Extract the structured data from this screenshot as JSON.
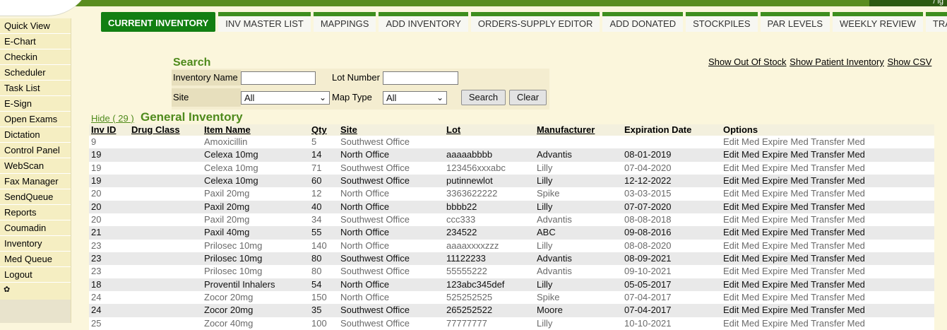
{
  "tabs": [
    "CURRENT INVENTORY",
    "INV MASTER LIST",
    "MAPPINGS",
    "ADD INVENTORY",
    "ORDERS-SUPPLY EDITOR",
    "ADD DONATED",
    "STOCKPILES",
    "PAR LEVELS",
    "WEEKLY REVIEW",
    "TRANSACTIO"
  ],
  "sidebar": [
    "Quick View",
    "E-Chart",
    "Checkin",
    "Scheduler",
    "Task List",
    "E-Sign",
    "Open Exams",
    "Dictation",
    "Control Panel",
    "WebScan",
    "Fax Manager",
    "SendQueue",
    "Reports",
    "Coumadin",
    "Inventory",
    "Med Queue",
    "Logout"
  ],
  "topbar_text": "/ ig",
  "search": {
    "title": "Search",
    "inventory_name_label": "Inventory Name",
    "lot_number_label": "Lot Number",
    "site_label": "Site",
    "site_value": "All",
    "map_type_label": "Map Type",
    "map_type_value": "All",
    "search_button": "Search",
    "clear_button": "Clear"
  },
  "links": {
    "out_of_stock": "Show Out Of Stock",
    "patient_inventory": "Show Patient Inventory",
    "csv": "Show CSV"
  },
  "section": {
    "hide": "Hide ( 29 )",
    "title": "General Inventory"
  },
  "table": {
    "headers": [
      "Inv ID",
      "Drug Class",
      "Item Name",
      "Qty",
      "Site",
      "Lot",
      "Manufacturer",
      "Expiration Date",
      "Options"
    ],
    "options": [
      "Edit Med",
      "Expire Med",
      "Transfer Med"
    ],
    "rows": [
      {
        "inv_id": "9",
        "drug_class": "",
        "item": "Amoxicillin",
        "qty": "5",
        "site": "Southwest Office",
        "lot": "",
        "mfr": "",
        "exp": ""
      },
      {
        "inv_id": "19",
        "drug_class": "",
        "item": "Celexa 10mg",
        "qty": "14",
        "site": "North Office",
        "lot": "aaaaabbbb",
        "mfr": "Advantis",
        "exp": "08-01-2019"
      },
      {
        "inv_id": "19",
        "drug_class": "",
        "item": "Celexa 10mg",
        "qty": "71",
        "site": "Southwest Office",
        "lot": "123456xxxabc",
        "mfr": "Lilly",
        "exp": "07-04-2020"
      },
      {
        "inv_id": "19",
        "drug_class": "",
        "item": "Celexa 10mg",
        "qty": "60",
        "site": "Southwest Office",
        "lot": "putinnewlot",
        "mfr": "Lilly",
        "exp": "12-12-2022"
      },
      {
        "inv_id": "20",
        "drug_class": "",
        "item": "Paxil 20mg",
        "qty": "12",
        "site": "North Office",
        "lot": "3363622222",
        "mfr": "Spike",
        "exp": "03-03-2015"
      },
      {
        "inv_id": "20",
        "drug_class": "",
        "item": "Paxil 20mg",
        "qty": "40",
        "site": "North Office",
        "lot": "bbbb22",
        "mfr": "Lilly",
        "exp": "07-07-2020"
      },
      {
        "inv_id": "20",
        "drug_class": "",
        "item": "Paxil 20mg",
        "qty": "34",
        "site": "Southwest Office",
        "lot": "ccc333",
        "mfr": "Advantis",
        "exp": "08-08-2018"
      },
      {
        "inv_id": "21",
        "drug_class": "",
        "item": "Paxil 40mg",
        "qty": "55",
        "site": "North Office",
        "lot": "234522",
        "mfr": "ABC",
        "exp": "09-08-2016"
      },
      {
        "inv_id": "23",
        "drug_class": "",
        "item": "Prilosec 10mg",
        "qty": "140",
        "site": "North Office",
        "lot": "aaaaxxxxzzz",
        "mfr": "Lilly",
        "exp": "08-08-2020"
      },
      {
        "inv_id": "23",
        "drug_class": "",
        "item": "Prilosec 10mg",
        "qty": "80",
        "site": "Southwest Office",
        "lot": "11122233",
        "mfr": "Advantis",
        "exp": "08-09-2021"
      },
      {
        "inv_id": "23",
        "drug_class": "",
        "item": "Prilosec 10mg",
        "qty": "80",
        "site": "Southwest Office",
        "lot": "55555222",
        "mfr": "Advantis",
        "exp": "09-10-2021"
      },
      {
        "inv_id": "18",
        "drug_class": "",
        "item": "Proventil Inhalers",
        "qty": "54",
        "site": "North Office",
        "lot": "123abc345def",
        "mfr": "Lilly",
        "exp": "05-05-2017"
      },
      {
        "inv_id": "24",
        "drug_class": "",
        "item": "Zocor 20mg",
        "qty": "150",
        "site": "North Office",
        "lot": "525252525",
        "mfr": "Spike",
        "exp": "07-04-2017"
      },
      {
        "inv_id": "24",
        "drug_class": "",
        "item": "Zocor 20mg",
        "qty": "35",
        "site": "Southwest Office",
        "lot": "265252522",
        "mfr": "Moore",
        "exp": "07-04-2017"
      },
      {
        "inv_id": "25",
        "drug_class": "",
        "item": "Zocor 40mg",
        "qty": "100",
        "site": "Southwest Office",
        "lot": "77777777",
        "mfr": "Lilly",
        "exp": "10-10-2021"
      }
    ]
  }
}
